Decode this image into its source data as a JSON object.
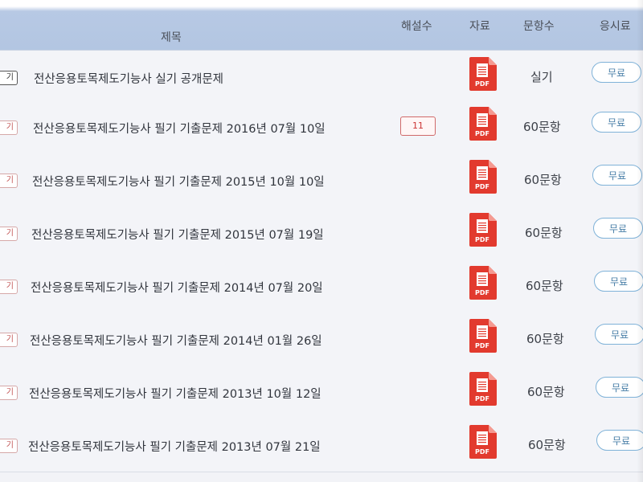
{
  "header": {
    "title": "제목",
    "explanations": "해설수",
    "material": "자료",
    "questions": "문항수",
    "fee": "응시료"
  },
  "icons": {
    "pdf": "pdf-file-icon",
    "pdf_color": "#e23a2e"
  },
  "rows": [
    {
      "tag": "기",
      "title": "전산응용토목제도기능사 실기 공개문제",
      "count": "",
      "pdf_label": "PDF",
      "questions": "실기",
      "fee": "무료"
    },
    {
      "tag": "기",
      "title": "전산응용토목제도기능사 필기 기출문제 2016년 07월 10일",
      "count": "11",
      "pdf_label": "PDF",
      "questions": "60문항",
      "fee": "무료"
    },
    {
      "tag": "기",
      "title": "전산응용토목제도기능사 필기 기출문제 2015년 10월 10일",
      "count": "",
      "pdf_label": "PDF",
      "questions": "60문항",
      "fee": "무료"
    },
    {
      "tag": "기",
      "title": "전산응용토목제도기능사 필기 기출문제 2015년 07월 19일",
      "count": "",
      "pdf_label": "PDF",
      "questions": "60문항",
      "fee": "무료"
    },
    {
      "tag": "기",
      "title": "전산응용토목제도기능사 필기 기출문제 2014년 07월 20일",
      "count": "",
      "pdf_label": "PDF",
      "questions": "60문항",
      "fee": "무료"
    },
    {
      "tag": "기",
      "title": "전산응용토목제도기능사 필기 기출문제 2014년 01월 26일",
      "count": "",
      "pdf_label": "PDF",
      "questions": "60문항",
      "fee": "무료"
    },
    {
      "tag": "기",
      "title": "전산응용토목제도기능사 필기 기출문제 2013년 10월 12일",
      "count": "",
      "pdf_label": "PDF",
      "questions": "60문항",
      "fee": "무료"
    },
    {
      "tag": "기",
      "title": "전산응용토목제도기능사 필기 기출문제 2013년 07월 21일",
      "count": "",
      "pdf_label": "PDF",
      "questions": "60문항",
      "fee": "무료"
    }
  ]
}
